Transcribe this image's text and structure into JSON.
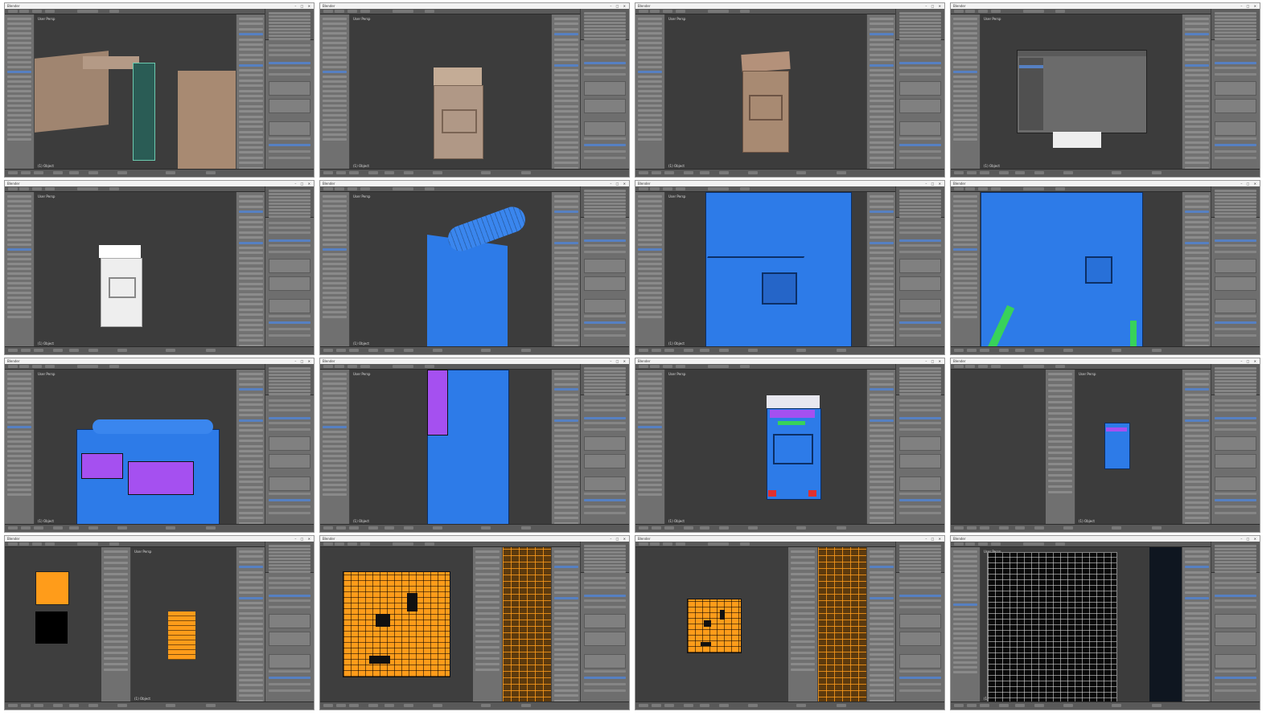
{
  "app": {
    "window_title": "Blender",
    "window_controls": "– □ ✕",
    "viewport_label": "User Persp",
    "viewport_status": "(1) Object"
  },
  "colors": {
    "accent": "#5680c2",
    "viewport_bg": "#3c3c3c",
    "panel": "#727272",
    "mesh_clay": "#a08570",
    "mesh_white": "#eeeeee",
    "mesh_blue": "#2d7be8",
    "mesh_purple": "#a550f0",
    "mesh_green": "#38d25a",
    "mesh_red": "#e03030",
    "uv_orange": "#ff9c1a",
    "uv_white": "#e6e6e6"
  },
  "frames": [
    {
      "id": "f01",
      "scene": "clay-kitbash",
      "tool": "3d"
    },
    {
      "id": "f02",
      "scene": "clay-panel",
      "tool": "3d"
    },
    {
      "id": "f03",
      "scene": "clay-panel-angled",
      "tool": "3d"
    },
    {
      "id": "f04",
      "scene": "preferences-dialog",
      "tool": "3d"
    },
    {
      "id": "f05",
      "scene": "white-panel",
      "tool": "paint"
    },
    {
      "id": "f06",
      "scene": "blue-cylinder",
      "tool": "3d"
    },
    {
      "id": "f07",
      "scene": "blue-closeup",
      "tool": "3d"
    },
    {
      "id": "f08",
      "scene": "blue-green-pipes",
      "tool": "3d"
    },
    {
      "id": "f09",
      "scene": "blue-purple-panels",
      "tool": "3d"
    },
    {
      "id": "f10",
      "scene": "blue-purple-side",
      "tool": "3d"
    },
    {
      "id": "f11",
      "scene": "blue-front",
      "tool": "3d"
    },
    {
      "id": "f12",
      "scene": "blue-small-node",
      "tool": "split"
    },
    {
      "id": "f13",
      "scene": "uv-thumb",
      "tool": "uv"
    },
    {
      "id": "f14",
      "scene": "uv-orange-full",
      "tool": "uv"
    },
    {
      "id": "f15",
      "scene": "uv-orange-split",
      "tool": "uv"
    },
    {
      "id": "f16",
      "scene": "uv-white",
      "tool": "uv"
    }
  ]
}
